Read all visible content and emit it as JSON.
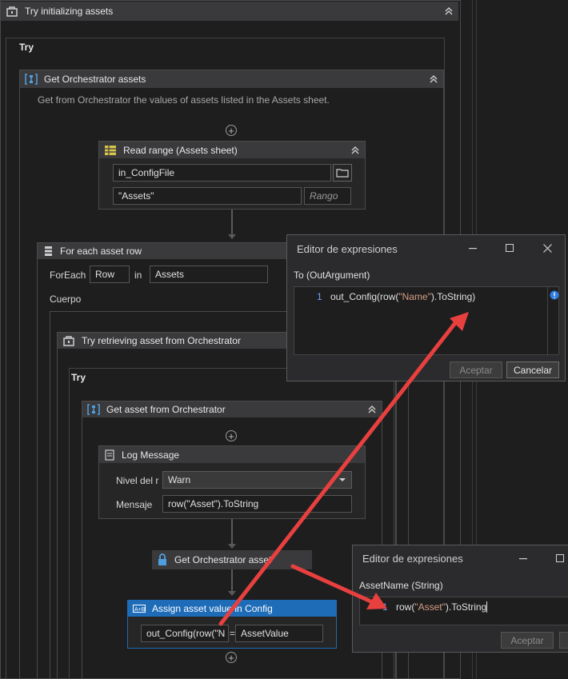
{
  "outer_try": {
    "title": "Try initializing assets",
    "try_label": "Try"
  },
  "get_assets": {
    "title": "Get Orchestrator assets",
    "description": "Get from Orchestrator the values of assets listed in the Assets sheet."
  },
  "read_range": {
    "title": "Read range (Assets sheet)",
    "file_value": "in_ConfigFile",
    "sheet_value": "\"Assets\"",
    "range_placeholder": "Rango"
  },
  "foreach": {
    "title": "For each asset row",
    "foreach_label": "ForEach",
    "item_value": "Row",
    "in_label": "in",
    "collection_value": "Assets",
    "body_label": "Cuerpo"
  },
  "inner_try": {
    "title": "Try retrieving asset from Orchestrator",
    "try_label": "Try"
  },
  "get_asset_seq": {
    "title": "Get asset from Orchestrator"
  },
  "log_message": {
    "title": "Log Message",
    "level_label": "Nivel del r",
    "level_value": "Warn",
    "message_label": "Mensaje",
    "message_value": "row(\"Asset\").ToString"
  },
  "get_asset": {
    "title": "Get Orchestrator asset"
  },
  "assign": {
    "title": "Assign asset value in Config",
    "left_value": "out_Config(row(\"N",
    "eq": "=",
    "right_value": "AssetValue"
  },
  "dialog1": {
    "title": "Editor de expresiones",
    "argument_label": "To (OutArgument)",
    "line_number": "1",
    "code_a": "out_Config(row(",
    "code_str": "\"Name\"",
    "code_b": ").ToString)",
    "accept_label": "Aceptar",
    "cancel_label": "Cancelar"
  },
  "dialog2": {
    "title": "Editor de expresiones",
    "argument_label": "AssetName (String)",
    "line_number": "1",
    "code_a": "row(",
    "code_str": "\"Asset\"",
    "code_b": ").ToString",
    "accept_label": "Aceptar"
  },
  "colors": {
    "arrow": "#e8403f",
    "selected": "#1e6bb8",
    "header": "#3a3a3d"
  }
}
